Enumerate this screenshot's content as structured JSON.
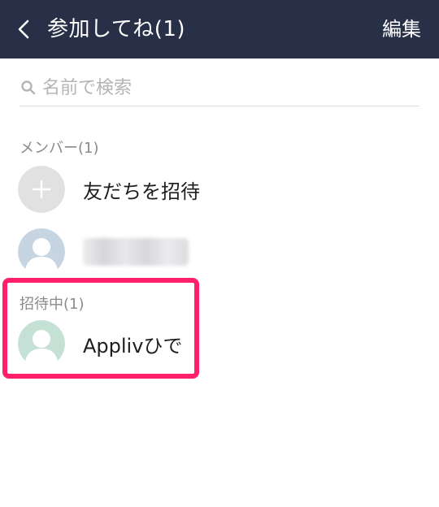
{
  "header": {
    "back_icon": "chevron-left-icon",
    "title": "参加してね(1)",
    "edit_label": "編集"
  },
  "search": {
    "icon": "search-icon",
    "placeholder": "名前で検索"
  },
  "members": {
    "label": "メンバー(1)",
    "invite_friends_label": "友だちを招待",
    "member_name_visible": false
  },
  "inviting": {
    "label": "招待中(1)",
    "items": [
      {
        "name": "Applivひで"
      }
    ]
  },
  "colors": {
    "header_bg": "#283048",
    "highlight": "#ff1f6a",
    "avatar_blue": "#c7d5e3",
    "avatar_green": "#c5e0d4",
    "add_circle": "#e1e1e1"
  }
}
